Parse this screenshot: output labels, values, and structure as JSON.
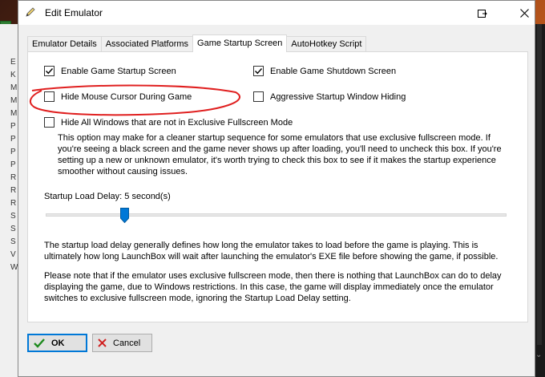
{
  "window": {
    "title": "Edit Emulator"
  },
  "tabs": [
    {
      "label": "Emulator Details",
      "active": false
    },
    {
      "label": "Associated Platforms",
      "active": false
    },
    {
      "label": "Game Startup Screen",
      "active": true
    },
    {
      "label": "AutoHotkey Script",
      "active": false
    }
  ],
  "options": {
    "enable_startup": {
      "label": "Enable Game Startup Screen",
      "checked": true
    },
    "enable_shutdown": {
      "label": "Enable Game Shutdown Screen",
      "checked": true
    },
    "hide_cursor": {
      "label": "Hide Mouse Cursor During Game",
      "checked": false
    },
    "aggressive_hiding": {
      "label": "Aggressive Startup Window Hiding",
      "checked": false
    },
    "hide_windows": {
      "label": "Hide All Windows that are not in Exclusive Fullscreen Mode",
      "checked": false
    }
  },
  "hide_windows_help": "This option may make for a cleaner startup sequence for some emulators that use exclusive fullscreen mode. If you're seeing a black screen and the game never shows up after loading, you'll need to uncheck this box. If you're setting up a new or unknown emulator, it's worth trying to check this box to see if it makes the startup experience smoother without causing issues.",
  "delay": {
    "label": "Startup Load Delay: 5 second(s)",
    "value": 5
  },
  "delay_help_1": "The startup load delay generally defines how long the emulator takes to load before the game is playing. This is ultimately how long LaunchBox will wait after launching the emulator's EXE file before showing the game, if possible.",
  "delay_help_2": "Please note that if the emulator uses exclusive fullscreen mode, then there is nothing that LaunchBox can do to delay displaying the game, due to Windows restrictions. In this case, the game will display immediately once the emulator switches to exclusive fullscreen mode, ignoring the Startup Load Delay setting.",
  "buttons": {
    "ok": "OK",
    "cancel": "Cancel"
  },
  "background_list_letters": [
    "E",
    "K",
    "M",
    "M",
    "M",
    "P",
    "P",
    "P",
    "P",
    "R",
    "R",
    "R",
    "S",
    "S",
    "S",
    "V",
    "W"
  ],
  "colors": {
    "accent": "#0078d7",
    "annotation": "#e02020",
    "ok_check": "#1e8a1e",
    "cancel_x": "#d02020"
  }
}
